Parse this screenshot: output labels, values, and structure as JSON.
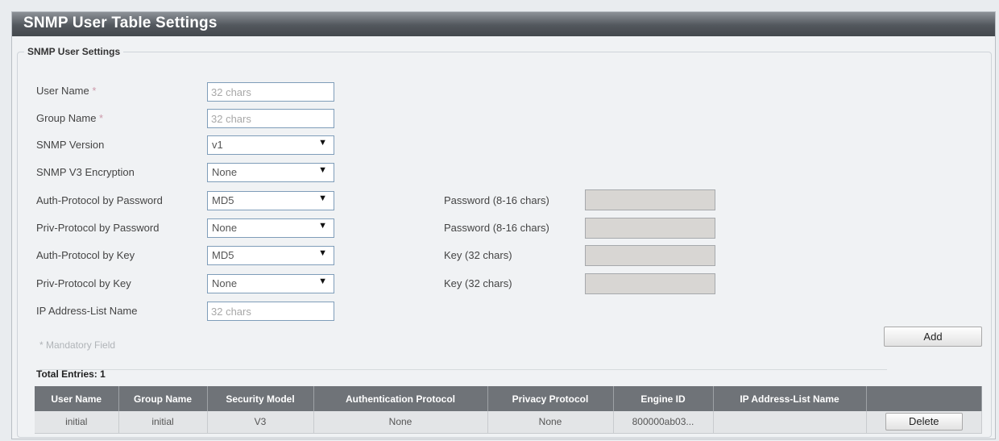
{
  "window": {
    "title": "SNMP User Table Settings"
  },
  "settings": {
    "legend": "SNMP User Settings",
    "user_name": {
      "label": "User Name",
      "required_mark": "*",
      "placeholder": "32 chars",
      "value": ""
    },
    "group_name": {
      "label": "Group Name",
      "required_mark": "*",
      "placeholder": "32 chars",
      "value": ""
    },
    "snmp_version": {
      "label": "SNMP Version",
      "value": "v1"
    },
    "v3_encryption": {
      "label": "SNMP V3 Encryption",
      "value": "None"
    },
    "auth_by_password": {
      "label": "Auth-Protocol by Password",
      "value": "MD5",
      "password_label": "Password (8-16 chars)"
    },
    "priv_by_password": {
      "label": "Priv-Protocol by Password",
      "value": "None",
      "password_label": "Password (8-16 chars)"
    },
    "auth_by_key": {
      "label": "Auth-Protocol by Key",
      "value": "MD5",
      "key_label": "Key (32 chars)"
    },
    "priv_by_key": {
      "label": "Priv-Protocol by Key",
      "value": "None",
      "key_label": "Key (32 chars)"
    },
    "ip_list_name": {
      "label": "IP Address-List Name",
      "placeholder": "32 chars",
      "value": ""
    },
    "mandatory_note": "* Mandatory Field",
    "add_label": "Add"
  },
  "table": {
    "total_label": "Total Entries: 1",
    "columns": [
      "User Name",
      "Group Name",
      "Security Model",
      "Authentication Protocol",
      "Privacy Protocol",
      "Engine ID",
      "IP Address-List Name",
      ""
    ],
    "rows": [
      {
        "user_name": "initial",
        "group_name": "initial",
        "security_model": "V3",
        "auth_protocol": "None",
        "privacy_protocol": "None",
        "engine_id": "800000ab03...",
        "ip_list": "",
        "delete_label": "Delete"
      }
    ]
  },
  "icons": {
    "dropdown": "triangle-down-icon"
  },
  "colors": {
    "title_bar": "#52575d",
    "header": "#6f7378",
    "background": "#f0f2f4"
  }
}
